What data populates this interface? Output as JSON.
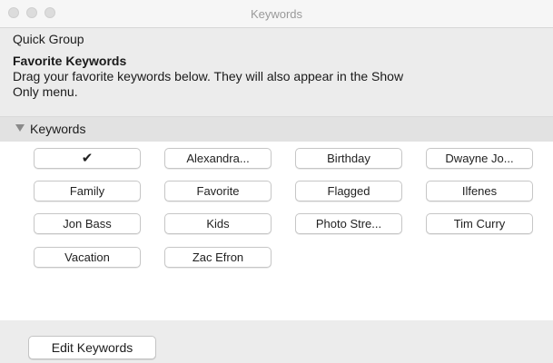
{
  "window": {
    "title": "Keywords"
  },
  "quick_group": {
    "label": "Quick Group"
  },
  "favorites": {
    "heading": "Favorite Keywords",
    "line1": "Drag your favorite keywords below. They will also appear in the Show",
    "line2": "Only menu."
  },
  "keywords_section": {
    "label": "Keywords"
  },
  "keywords": [
    [
      "✔",
      "Alexandra...",
      "Birthday",
      "Dwayne Jo..."
    ],
    [
      "Family",
      "Favorite",
      "Flagged",
      "Ilfenes"
    ],
    [
      "Jon Bass",
      "Kids",
      "Photo Stre...",
      "Tim Curry"
    ],
    [
      "Vacation",
      "Zac Efron"
    ]
  ],
  "footer": {
    "edit_label": "Edit Keywords"
  }
}
